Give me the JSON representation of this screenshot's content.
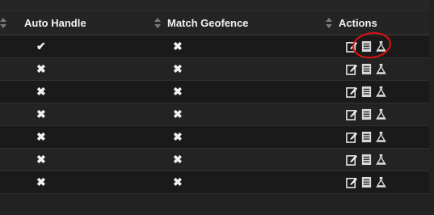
{
  "table": {
    "columns": [
      {
        "label": "Auto Handle",
        "sortable": true
      },
      {
        "label": "Match Geofence",
        "sortable": true
      },
      {
        "label": "Actions",
        "sortable": false
      }
    ],
    "rows": [
      {
        "auto_handle": "✔",
        "match_geofence": "✖"
      },
      {
        "auto_handle": "✖",
        "match_geofence": "✖"
      },
      {
        "auto_handle": "✖",
        "match_geofence": "✖"
      },
      {
        "auto_handle": "✖",
        "match_geofence": "✖"
      },
      {
        "auto_handle": "✖",
        "match_geofence": "✖"
      },
      {
        "auto_handle": "✖",
        "match_geofence": "✖"
      },
      {
        "auto_handle": "✖",
        "match_geofence": "✖"
      }
    ],
    "row_actions": [
      "edit-icon",
      "document-list-icon",
      "flask-icon"
    ]
  },
  "colors": {
    "background": "#222222",
    "row_odd": "#1a1a1a",
    "row_even": "#232323",
    "highlight_ring": "#e01010"
  },
  "annotations": {
    "highlight": "red hand-drawn circle around the document-list icon of first row"
  }
}
